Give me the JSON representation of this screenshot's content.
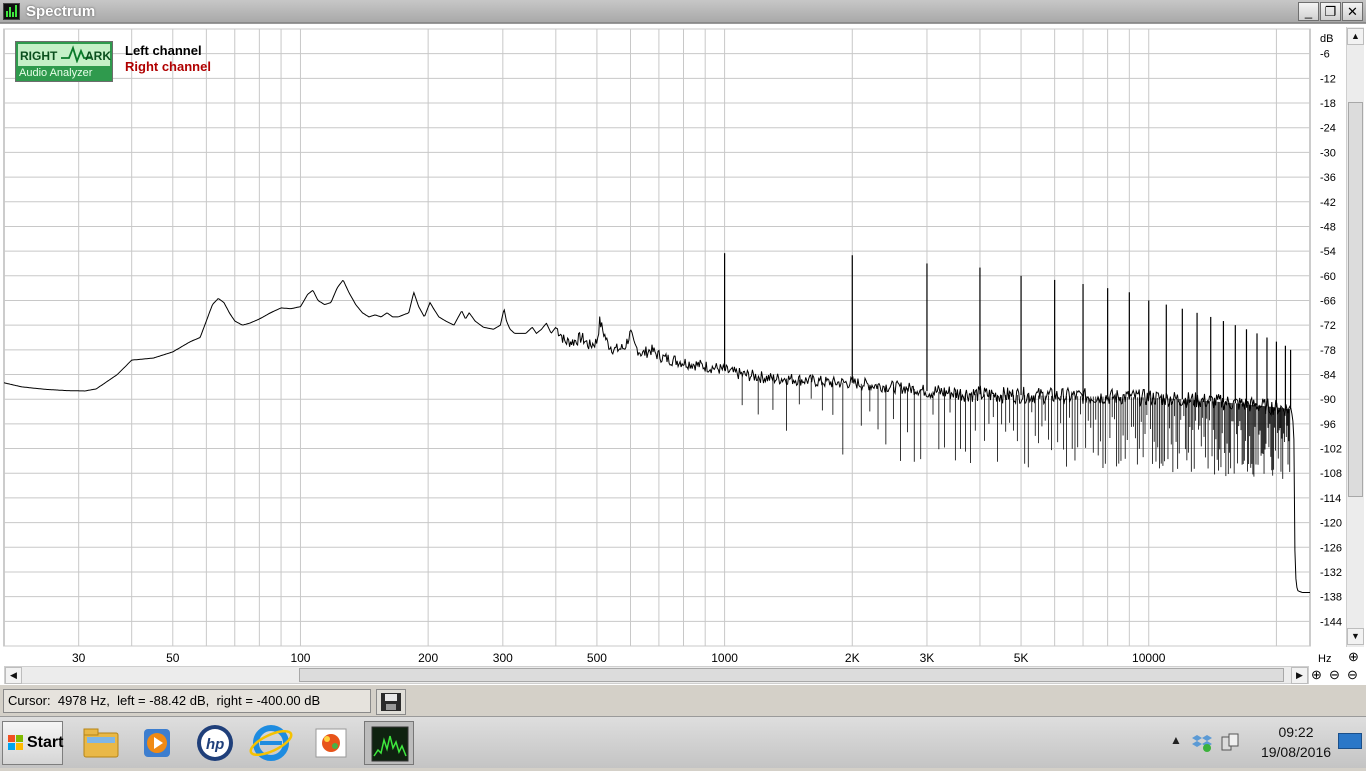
{
  "window": {
    "title": "Spectrum",
    "controls": {
      "minimize": "_",
      "restore": "❐",
      "close": "✕"
    }
  },
  "logo": {
    "line1a": "RIGHT",
    "line1b": "ARK",
    "line2": "Audio Analyzer"
  },
  "legend": [
    {
      "label": "Left channel",
      "color": "#000000"
    },
    {
      "label": "Right channel",
      "color": "#b00000"
    }
  ],
  "status": {
    "cursor_text": "Cursor:  4978 Hz,  left = -88.42 dB,  right = -400.00 dB"
  },
  "taskbar": {
    "start_label": "Start",
    "apps": [
      "folder-icon",
      "media-player-icon",
      "hp-icon",
      "internet-explorer-icon",
      "paint-icon",
      "rmaa-spectrum-icon"
    ],
    "clock_time": "09:22",
    "clock_date": "19/08/2016"
  },
  "chart_data": {
    "type": "line",
    "title": "",
    "xlabel": "Hz",
    "ylabel": "dB",
    "x_scale": "log",
    "xlim": [
      20,
      24000
    ],
    "ylim": [
      -150,
      0
    ],
    "grid": true,
    "legend_position": "top-left",
    "x_tick_labels": [
      {
        "value": 30,
        "label": "30"
      },
      {
        "value": 50,
        "label": "50"
      },
      {
        "value": 100,
        "label": "100"
      },
      {
        "value": 200,
        "label": "200"
      },
      {
        "value": 300,
        "label": "300"
      },
      {
        "value": 500,
        "label": "500"
      },
      {
        "value": 1000,
        "label": "1000"
      },
      {
        "value": 2000,
        "label": "2K"
      },
      {
        "value": 3000,
        "label": "3K"
      },
      {
        "value": 5000,
        "label": "5K"
      },
      {
        "value": 10000,
        "label": "10000"
      }
    ],
    "y_ticks": [
      -6,
      -12,
      -18,
      -24,
      -30,
      -36,
      -42,
      -48,
      -54,
      -60,
      -66,
      -72,
      -78,
      -84,
      -90,
      -96,
      -102,
      -108,
      -114,
      -120,
      -126,
      -132,
      -138,
      -144
    ],
    "series": [
      {
        "name": "Left channel",
        "color": "#000000",
        "points": [
          [
            20,
            -86
          ],
          [
            22,
            -87
          ],
          [
            25,
            -87.6
          ],
          [
            28,
            -87.9
          ],
          [
            31,
            -88
          ],
          [
            33,
            -87.5
          ],
          [
            37,
            -84
          ],
          [
            40,
            -80.5
          ],
          [
            45,
            -80
          ],
          [
            50,
            -78.5
          ],
          [
            55,
            -76
          ],
          [
            58,
            -75
          ],
          [
            60,
            -71
          ],
          [
            62,
            -67
          ],
          [
            64,
            -65.5
          ],
          [
            66,
            -66.5
          ],
          [
            68,
            -69
          ],
          [
            70,
            -71
          ],
          [
            73,
            -72
          ],
          [
            76,
            -71.5
          ],
          [
            80,
            -70.5
          ],
          [
            85,
            -69
          ],
          [
            90,
            -67.8
          ],
          [
            95,
            -68
          ],
          [
            100,
            -67.5
          ],
          [
            104,
            -64.5
          ],
          [
            107,
            -63.5
          ],
          [
            110,
            -66
          ],
          [
            114,
            -67
          ],
          [
            118,
            -66.5
          ],
          [
            122,
            -63
          ],
          [
            126,
            -61
          ],
          [
            130,
            -64
          ],
          [
            135,
            -67
          ],
          [
            140,
            -69
          ],
          [
            145,
            -70
          ],
          [
            150,
            -69.5
          ],
          [
            155,
            -70
          ],
          [
            160,
            -69
          ],
          [
            165,
            -70
          ],
          [
            170,
            -70
          ],
          [
            180,
            -69
          ],
          [
            185,
            -64
          ],
          [
            190,
            -67.5
          ],
          [
            196,
            -70
          ],
          [
            202,
            -66.5
          ],
          [
            206,
            -68
          ],
          [
            212,
            -70
          ],
          [
            220,
            -71
          ],
          [
            230,
            -72
          ],
          [
            240,
            -68.5
          ],
          [
            245,
            -70.5
          ],
          [
            250,
            -69
          ],
          [
            258,
            -71
          ],
          [
            270,
            -72.5
          ],
          [
            285,
            -73
          ],
          [
            296,
            -72
          ],
          [
            302,
            -68
          ],
          [
            306,
            -71
          ],
          [
            312,
            -73
          ],
          [
            320,
            -74
          ],
          [
            340,
            -74
          ],
          [
            352,
            -72.5
          ],
          [
            360,
            -74
          ],
          [
            370,
            -73
          ],
          [
            380,
            -71.5
          ],
          [
            390,
            -74
          ],
          [
            400,
            -72.5
          ],
          [
            410,
            -74
          ],
          [
            420,
            -76
          ],
          [
            440,
            -76
          ],
          [
            460,
            -75
          ],
          [
            470,
            -76
          ],
          [
            480,
            -77
          ],
          [
            500,
            -76
          ],
          [
            508,
            -71
          ],
          [
            515,
            -73
          ],
          [
            530,
            -76.5
          ],
          [
            550,
            -78
          ],
          [
            580,
            -77.5
          ],
          [
            600,
            -74
          ],
          [
            612,
            -77
          ],
          [
            640,
            -79
          ],
          [
            670,
            -78
          ],
          [
            690,
            -79
          ],
          [
            720,
            -80
          ],
          [
            760,
            -80.5
          ],
          [
            800,
            -81
          ],
          [
            850,
            -81.5
          ],
          [
            900,
            -82
          ],
          [
            960,
            -82.5
          ],
          [
            1000,
            -83
          ],
          [
            1040,
            -83.5
          ],
          [
            1100,
            -84
          ],
          [
            1200,
            -84.5
          ],
          [
            1300,
            -85
          ],
          [
            1400,
            -85
          ],
          [
            1600,
            -85.5
          ],
          [
            1800,
            -86
          ],
          [
            2000,
            -86
          ],
          [
            2200,
            -86.5
          ],
          [
            2500,
            -87
          ],
          [
            2800,
            -87.5
          ],
          [
            3000,
            -88
          ],
          [
            3500,
            -88.5
          ],
          [
            4000,
            -88.8
          ],
          [
            4500,
            -89
          ],
          [
            5000,
            -89
          ],
          [
            6000,
            -89.2
          ],
          [
            7000,
            -89.3
          ],
          [
            8000,
            -89.4
          ],
          [
            9000,
            -89.5
          ],
          [
            10000,
            -89.6
          ],
          [
            12000,
            -90
          ],
          [
            14000,
            -90.5
          ],
          [
            16000,
            -91
          ],
          [
            18000,
            -91.5
          ],
          [
            20000,
            -92
          ],
          [
            21800,
            -92.5
          ],
          [
            22000,
            -100
          ],
          [
            22050,
            -122
          ],
          [
            22200,
            -133
          ],
          [
            22400,
            -136.5
          ],
          [
            23000,
            -137
          ],
          [
            24000,
            -137
          ]
        ],
        "peaks": [
          [
            1000,
            -54.5
          ],
          [
            2000,
            -55
          ],
          [
            3000,
            -57
          ],
          [
            4000,
            -58
          ],
          [
            5000,
            -60
          ],
          [
            6000,
            -61
          ],
          [
            7000,
            -62
          ],
          [
            8000,
            -63
          ],
          [
            9000,
            -64
          ],
          [
            10000,
            -66
          ],
          [
            11000,
            -67
          ],
          [
            12000,
            -68
          ],
          [
            13000,
            -69
          ],
          [
            14000,
            -70
          ],
          [
            15000,
            -71
          ],
          [
            16000,
            -72
          ],
          [
            17000,
            -73
          ],
          [
            18000,
            -74
          ],
          [
            19000,
            -75
          ],
          [
            20000,
            -76
          ],
          [
            21000,
            -77
          ],
          [
            21600,
            -78
          ]
        ]
      },
      {
        "name": "Right channel",
        "color": "#b00000",
        "points": []
      }
    ]
  }
}
